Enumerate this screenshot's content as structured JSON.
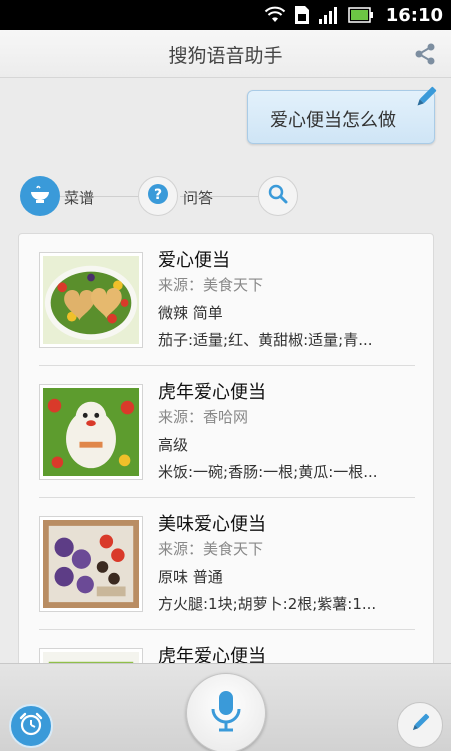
{
  "status_bar": {
    "time": "16:10",
    "icons": [
      "wifi-icon",
      "sim-icon",
      "signal-icon",
      "battery-icon"
    ]
  },
  "header": {
    "title": "搜狗语音助手",
    "share_icon": "share-icon"
  },
  "query": {
    "text": "爱心便当怎么做",
    "edit_icon": "pencil-icon"
  },
  "categories": [
    {
      "label": "菜谱",
      "icon": "bowl-icon",
      "active": true
    },
    {
      "label": "问答",
      "icon": "question-icon",
      "active": false
    },
    {
      "label": "",
      "icon": "search-icon",
      "active": false
    }
  ],
  "results": [
    {
      "name": "爱心便当",
      "source": "来源：美食天下",
      "taste": "微辣 简单",
      "ingredients": "茄子:适量;红、黄甜椒:适量;青..."
    },
    {
      "name": "虎年爱心便当",
      "source": "来源：香哈网",
      "taste": "高级",
      "ingredients": "米饭:一碗;香肠:一根;黄瓜:一根..."
    },
    {
      "name": "美味爱心便当",
      "source": "来源：美食天下",
      "taste": "原味 普通",
      "ingredients": "方火腿:1块;胡萝卜:2根;紫薯:1..."
    },
    {
      "name": "虎年爱心便当",
      "source": "",
      "taste": "",
      "ingredients": ""
    }
  ],
  "bottom_bar": {
    "left_icon": "alarm-clock-icon",
    "center_icon": "microphone-icon",
    "right_icon": "pencil-icon"
  },
  "colors": {
    "accent": "#3a9ad9",
    "status_bar": "#000000",
    "background": "#ebebeb"
  }
}
